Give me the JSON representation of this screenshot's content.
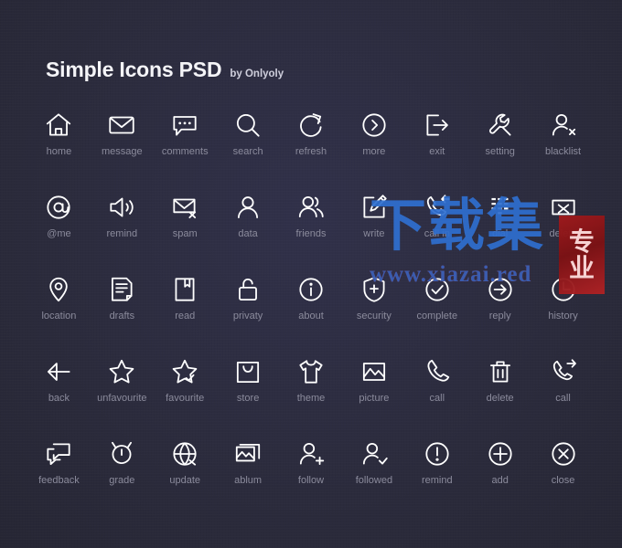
{
  "header": {
    "title": "Simple Icons PSD",
    "byline": "by Onlyoly"
  },
  "theme": {
    "background": "#2b2b3c",
    "title_color": "#f4f4f7",
    "label_color": "#8b8b9c",
    "icon_color": "#ffffff",
    "watermark_blue": "#2f6fd0",
    "watermark_seal_red": "#a11a1c"
  },
  "watermark": {
    "chinese_text": "下载集",
    "url_text": "www.xiazai.red",
    "seal_text_top": "专",
    "seal_text_bottom": "业"
  },
  "grid": {
    "columns": 9,
    "rows": 5,
    "icons": [
      {
        "label": "home",
        "icon": "home-icon"
      },
      {
        "label": "message",
        "icon": "envelope-icon"
      },
      {
        "label": "comments",
        "icon": "comment-bubble-icon"
      },
      {
        "label": "search",
        "icon": "magnifier-icon"
      },
      {
        "label": "refresh",
        "icon": "refresh-arrow-icon"
      },
      {
        "label": "more",
        "icon": "chevron-right-circle-icon"
      },
      {
        "label": "exit",
        "icon": "exit-arrow-icon"
      },
      {
        "label": "setting",
        "icon": "wrench-icon"
      },
      {
        "label": "blacklist",
        "icon": "user-x-icon"
      },
      {
        "label": "@me",
        "icon": "at-circle-icon"
      },
      {
        "label": "remind",
        "icon": "speaker-icon"
      },
      {
        "label": "spam",
        "icon": "envelope-x-icon"
      },
      {
        "label": "data",
        "icon": "user-icon"
      },
      {
        "label": "friends",
        "icon": "users-icon"
      },
      {
        "label": "write",
        "icon": "pencil-square-icon"
      },
      {
        "label": "call in",
        "icon": "phone-incoming-icon"
      },
      {
        "label": "dial",
        "icon": "dialpad-icon"
      },
      {
        "label": "delete",
        "icon": "envelope-delete-icon"
      },
      {
        "label": "location",
        "icon": "map-pin-icon"
      },
      {
        "label": "drafts",
        "icon": "draft-page-icon"
      },
      {
        "label": "read",
        "icon": "book-read-icon"
      },
      {
        "label": "privaty",
        "icon": "unlock-icon"
      },
      {
        "label": "about",
        "icon": "info-circle-icon"
      },
      {
        "label": "security",
        "icon": "shield-plus-icon"
      },
      {
        "label": "complete",
        "icon": "check-circle-icon"
      },
      {
        "label": "reply",
        "icon": "arrow-right-circle-icon"
      },
      {
        "label": "history",
        "icon": "clock-icon"
      },
      {
        "label": "back",
        "icon": "arrow-left-icon"
      },
      {
        "label": "unfavourite",
        "icon": "star-outline-icon"
      },
      {
        "label": "favourite",
        "icon": "star-check-icon"
      },
      {
        "label": "store",
        "icon": "shopping-bag-icon"
      },
      {
        "label": "theme",
        "icon": "tshirt-icon"
      },
      {
        "label": "picture",
        "icon": "image-icon"
      },
      {
        "label": "call",
        "icon": "phone-icon"
      },
      {
        "label": "delete",
        "icon": "trash-icon"
      },
      {
        "label": "call",
        "icon": "phone-forward-icon"
      },
      {
        "label": "feedback",
        "icon": "chat-windows-icon"
      },
      {
        "label": "grade",
        "icon": "medal-icon"
      },
      {
        "label": "update",
        "icon": "globe-refresh-icon"
      },
      {
        "label": "ablum",
        "icon": "photo-stack-icon"
      },
      {
        "label": "follow",
        "icon": "user-plus-icon"
      },
      {
        "label": "followed",
        "icon": "user-check-icon"
      },
      {
        "label": "remind",
        "icon": "exclamation-circle-icon"
      },
      {
        "label": "add",
        "icon": "plus-circle-icon"
      },
      {
        "label": "close",
        "icon": "x-circle-icon"
      }
    ]
  }
}
